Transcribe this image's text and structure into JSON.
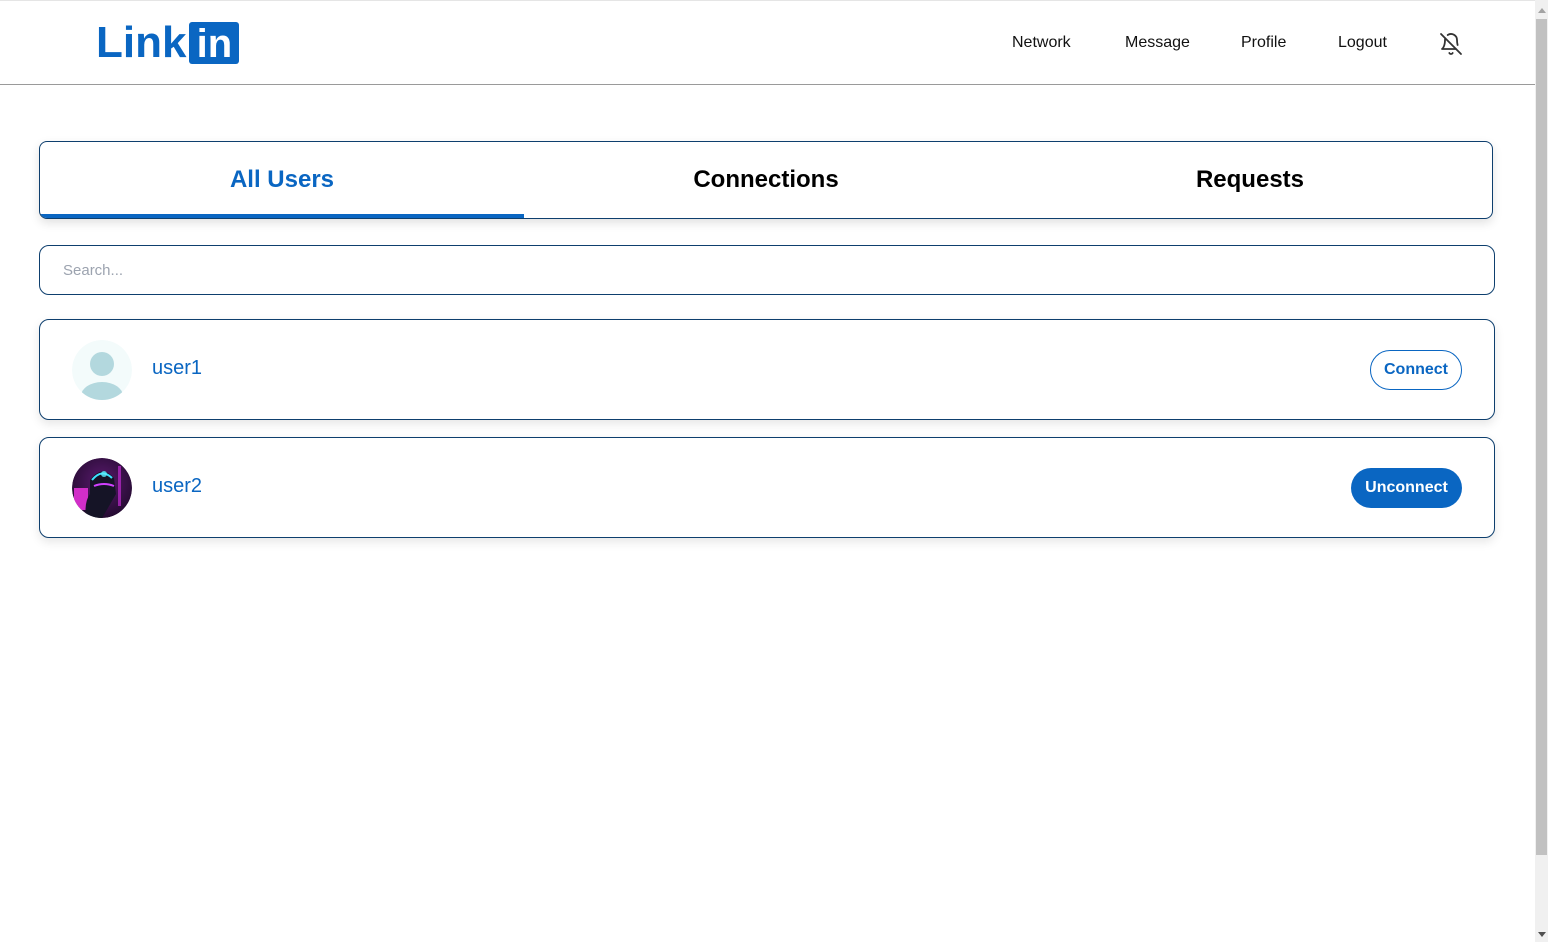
{
  "brand": {
    "logo_text": "Link",
    "logo_box_text": "in",
    "color": "#0a66c2"
  },
  "nav": {
    "links": [
      {
        "label": "Network"
      },
      {
        "label": "Message"
      },
      {
        "label": "Profile"
      },
      {
        "label": "Logout"
      }
    ],
    "notification_icon": "bell-off-icon"
  },
  "tabs": [
    {
      "label": "All Users",
      "active": true
    },
    {
      "label": "Connections",
      "active": false
    },
    {
      "label": "Requests",
      "active": false
    }
  ],
  "search": {
    "placeholder": "Search...",
    "value": ""
  },
  "users": [
    {
      "name": "user1",
      "avatar": "default-avatar",
      "action_label": "Connect",
      "action_style": "outline"
    },
    {
      "name": "user2",
      "avatar": "cyberpunk-helmet-avatar",
      "action_label": "Unconnect",
      "action_style": "solid"
    }
  ]
}
